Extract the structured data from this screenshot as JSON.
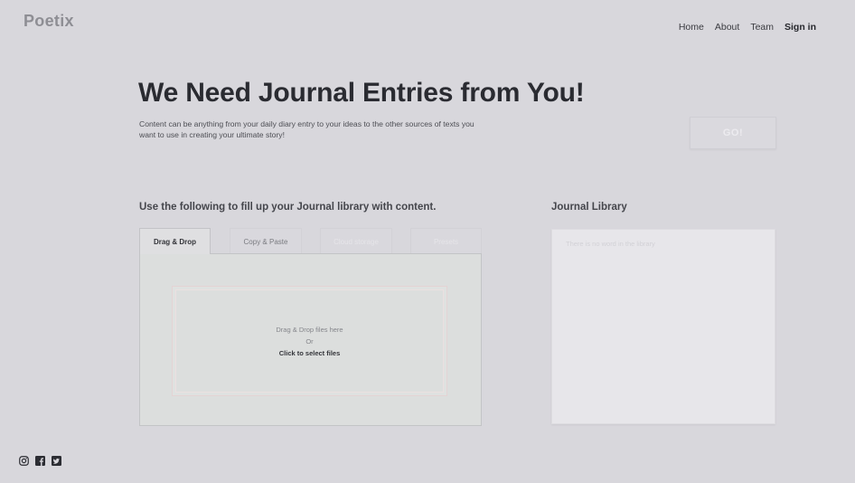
{
  "header": {
    "logo": "Poetix",
    "nav": [
      "Home",
      "About",
      "Team"
    ],
    "signin": "Sign in"
  },
  "hero": {
    "title": "We Need Journal Entries from You!",
    "description": "Content can be anything from your daily diary entry to your ideas to the other sources of texts you want to use in creating your ultimate story!",
    "go_label": "GO!"
  },
  "upload": {
    "heading": "Use the following to fill up your Journal library with content.",
    "tabs": [
      "Drag & Drop",
      "Copy & Paste",
      "Cloud storage",
      "Presets"
    ],
    "active_tab": 0,
    "dropzone": {
      "line1": "Drag & Drop files here",
      "line2": "Or",
      "click": "Click to select files"
    }
  },
  "library": {
    "heading": "Journal Library",
    "empty_text": "There is no word in the library"
  },
  "footer": {
    "social_icons": [
      "instagram-icon",
      "facebook-icon",
      "twitter-icon"
    ]
  },
  "colors": {
    "background": "#d8d7dc",
    "text_dark": "#2c2d33",
    "logo": "#8e8e94"
  }
}
